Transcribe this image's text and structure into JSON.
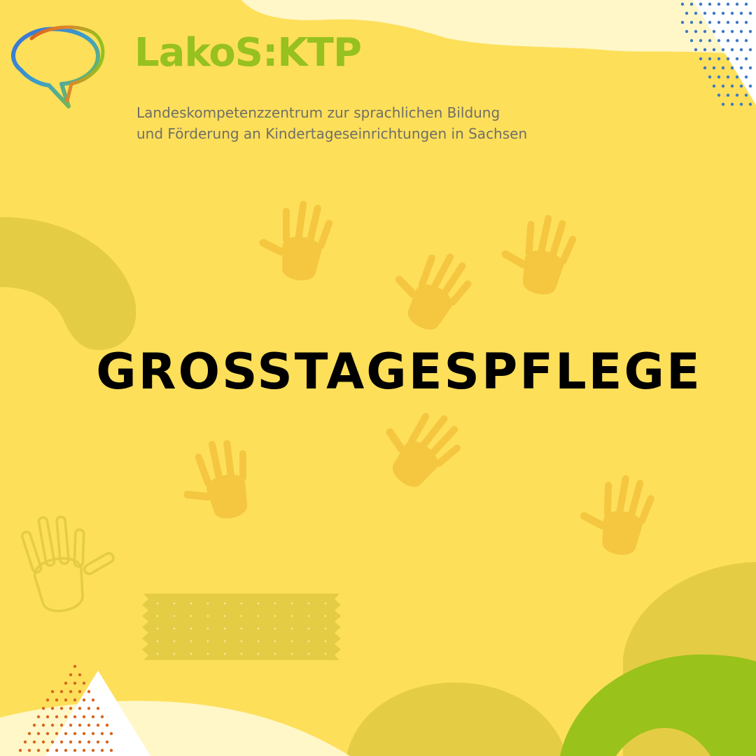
{
  "brand": {
    "name": "LakoS:KTP",
    "subtitle_line1": "Landeskompetenzzentrum zur sprachlichen Bildung",
    "subtitle_line2": "und Förderung an Kindertageseinrichtungen in Sachsen",
    "logo_icon": "speech-bubbles-icon"
  },
  "headline": "GROSSTAGESPFLEGE",
  "colors": {
    "background": "#fddf5a",
    "brand_green": "#96c11f",
    "subtitle_gray": "#6f6f66",
    "headline": "#000000",
    "cream": "#fff7c8",
    "mustard": "#e5cc45",
    "handprint": "#f5c63f",
    "dot_blue": "#3d78c2",
    "dot_orange": "#d9661e"
  },
  "decorations": [
    "handprint-icon",
    "speech-bubbles-icon",
    "tape-strip",
    "dot-pattern",
    "arc-shape"
  ]
}
